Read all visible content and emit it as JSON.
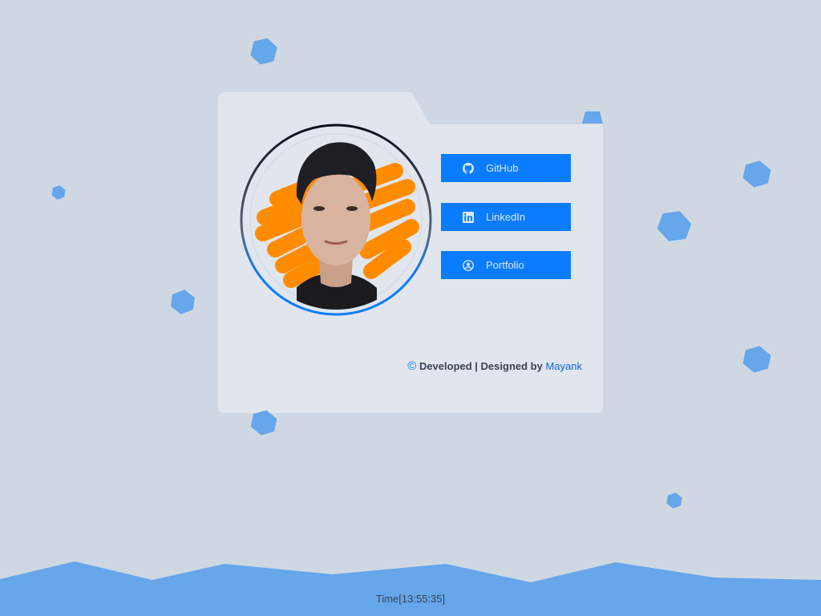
{
  "links": {
    "github": {
      "label": "GitHub",
      "icon": "github-icon"
    },
    "linkedin": {
      "label": "LinkedIn",
      "icon": "linkedin-icon"
    },
    "portfolio": {
      "label": "Portfolio",
      "icon": "user-circle-icon"
    }
  },
  "footer": {
    "copyright_symbol": "©",
    "credit_text": "Developed | Designed by",
    "author": "Mayank"
  },
  "clock": {
    "text": "Time[13:55:35]"
  },
  "colors": {
    "background": "#cfd8e2",
    "card": "#e1e6ee",
    "button": "#0a7cff",
    "accent_shape": "#ff8c00",
    "hexagon": "#66a6ea",
    "wave": "#66a6ea"
  }
}
